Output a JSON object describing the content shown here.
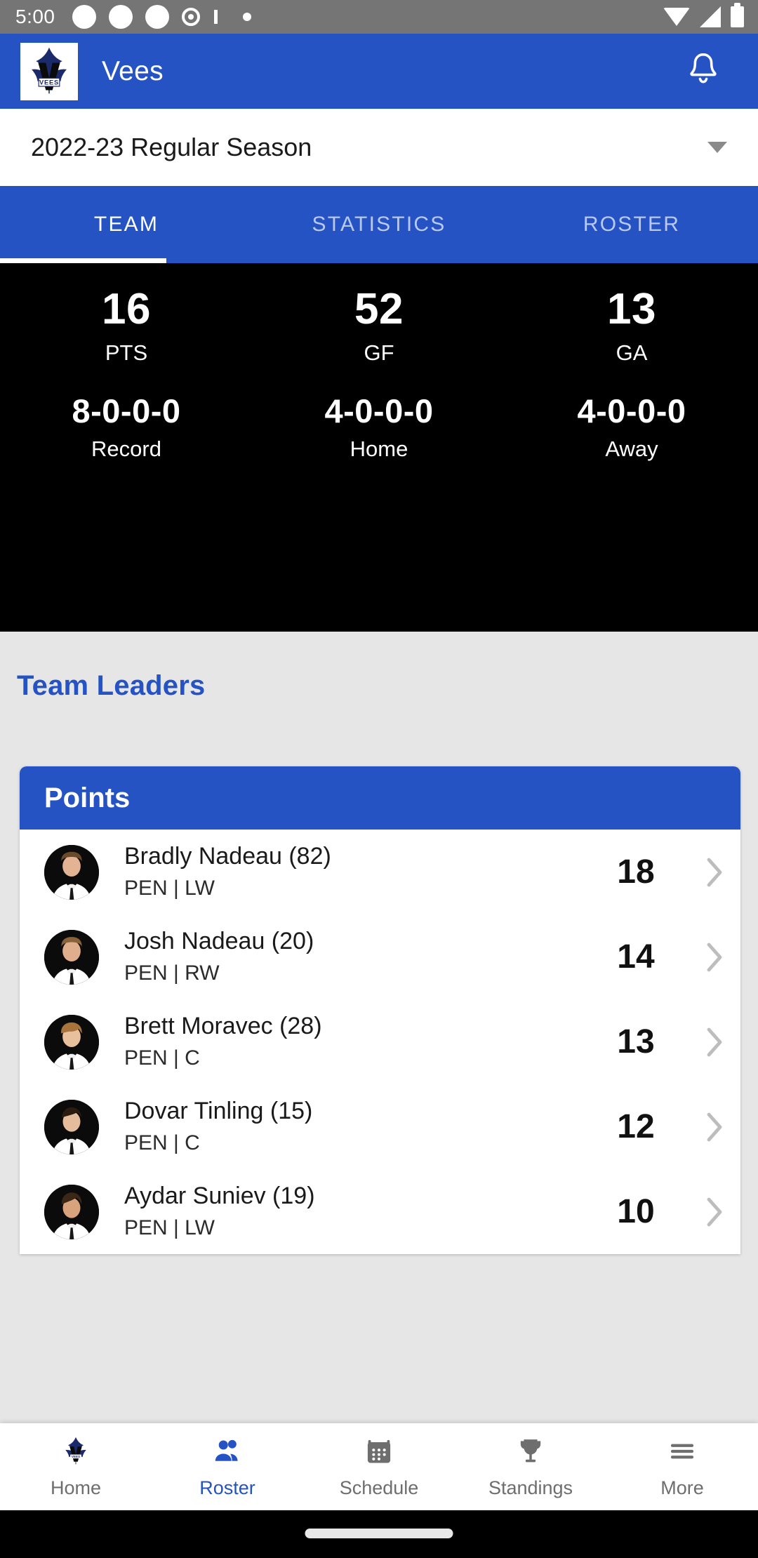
{
  "status_bar": {
    "time": "5:00",
    "left_icons": [
      "dot-icon",
      "dot-icon",
      "dot-icon",
      "alarm-ring-icon",
      "small-dot-icon"
    ],
    "right_icons": [
      "wifi-icon",
      "signal-icon",
      "battery-icon"
    ]
  },
  "app_bar": {
    "title": "Vees",
    "logo": "vees-team-logo",
    "notification_icon": "bell-icon"
  },
  "season_selector": {
    "value": "2022-23 Regular Season",
    "caret": "chevron-down-icon"
  },
  "tabs": [
    {
      "label": "TEAM",
      "active": true
    },
    {
      "label": "STATISTICS",
      "active": false
    },
    {
      "label": "ROSTER",
      "active": false
    }
  ],
  "team_stats": {
    "row1": [
      {
        "value": "16",
        "label": "PTS"
      },
      {
        "value": "52",
        "label": "GF"
      },
      {
        "value": "13",
        "label": "GA"
      }
    ],
    "row2": [
      {
        "value": "8-0-0-0",
        "label": "Record"
      },
      {
        "value": "4-0-0-0",
        "label": "Home"
      },
      {
        "value": "4-0-0-0",
        "label": "Away"
      }
    ]
  },
  "team_leaders": {
    "section_title": "Team Leaders",
    "card_title": "Points",
    "players": [
      {
        "name": "Bradly Nadeau (82)",
        "meta": "PEN | LW",
        "stat": "18"
      },
      {
        "name": "Josh Nadeau (20)",
        "meta": "PEN | RW",
        "stat": "14"
      },
      {
        "name": "Brett Moravec (28)",
        "meta": "PEN | C",
        "stat": "13"
      },
      {
        "name": "Dovar Tinling (15)",
        "meta": "PEN | C",
        "stat": "12"
      },
      {
        "name": "Aydar Suniev (19)",
        "meta": "PEN | LW",
        "stat": "10"
      }
    ]
  },
  "bottom_nav": [
    {
      "label": "Home",
      "icon": "team-logo-icon",
      "active": false
    },
    {
      "label": "Roster",
      "icon": "people-icon",
      "active": true
    },
    {
      "label": "Schedule",
      "icon": "calendar-icon",
      "active": false
    },
    {
      "label": "Standings",
      "icon": "trophy-icon",
      "active": false
    },
    {
      "label": "More",
      "icon": "hamburger-menu-icon",
      "active": false
    }
  ],
  "colors": {
    "brand_blue": "#2553c4",
    "tab_inactive": "#b9c9ee",
    "page_background": "#e6e6e6",
    "stats_background": "#000000",
    "nav_inactive": "#6e6e6e"
  }
}
